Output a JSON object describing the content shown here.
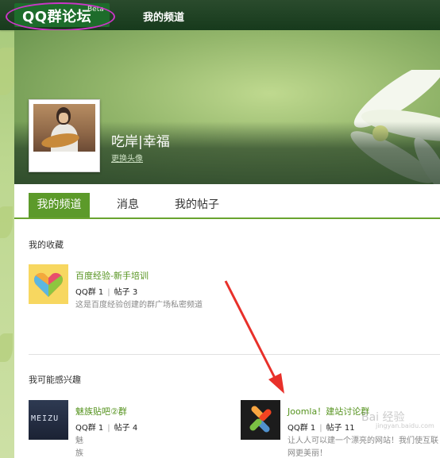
{
  "header": {
    "logo": "QQ群论坛",
    "logo_badge": "Beta",
    "nav_my_channel": "我的频道"
  },
  "profile": {
    "username": "吃岸|幸福",
    "change_avatar": "更换头像"
  },
  "tabs": [
    {
      "label": "我的频道",
      "active": true
    },
    {
      "label": "消息",
      "active": false
    },
    {
      "label": "我的帖子",
      "active": false
    }
  ],
  "favorites": {
    "title": "我的收藏",
    "items": [
      {
        "name": "百度经验-新手培训",
        "group_label": "QQ群 1",
        "posts_label": "帖子 3",
        "desc": "这是百度经验创建的群广场私密频道"
      }
    ]
  },
  "interests": {
    "title": "我可能感兴趣",
    "items": [
      {
        "name": "魅族贴吧②群",
        "group_label": "QQ群 1",
        "posts_label": "帖子 4",
        "desc": "魅族群",
        "thumb_text": "MEIZU"
      },
      {
        "name": "Joomla！建站讨论群",
        "group_label": "QQ群 1",
        "posts_label": "帖子 11",
        "desc": "让人人可以建一个漂亮的网站！我们使互联网更美丽！"
      }
    ]
  },
  "watermark": {
    "main": "Bai 经验",
    "sub": "jingyan.baidu.com"
  },
  "colors": {
    "nav_bg": "#1f3f23",
    "accent_green": "#5c9a2a",
    "link_green": "#55931e",
    "annotation_magenta": "#cc35c8",
    "annotation_red": "#e8302a"
  }
}
